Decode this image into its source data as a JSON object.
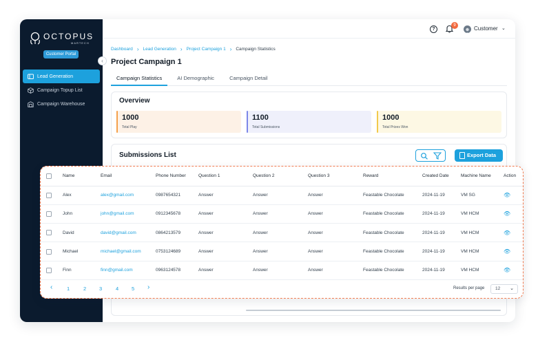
{
  "brand": {
    "name": "OCTOPUS",
    "sub": "MARTECH",
    "portal_badge": "Customer Portal"
  },
  "sidebar": {
    "items": [
      {
        "label": "Lead Generation",
        "icon": "megaphone-icon",
        "active": true
      },
      {
        "label": "Campaign Topup List",
        "icon": "box-icon",
        "active": false
      },
      {
        "label": "Campaign Warehouse",
        "icon": "warehouse-icon",
        "active": false
      }
    ]
  },
  "topbar": {
    "notification_count": "9",
    "user_label": "Customer"
  },
  "breadcrumb": [
    "Dashboard",
    "Lead Generation",
    "Project Campaign 1",
    "Campaign Statistics"
  ],
  "page_title": "Project Campaign 1",
  "tabs": [
    "Campaign Statistics",
    "AI Demographic",
    "Campaign Detail"
  ],
  "overview": {
    "title": "Overview",
    "stats": [
      {
        "value": "1000",
        "label": "Total Play",
        "color": "#f5a04a",
        "bg": "#fdf1e6"
      },
      {
        "value": "1100",
        "label": "Total Submissions",
        "color": "#7b86e8",
        "bg": "#eff0fb"
      },
      {
        "value": "1000",
        "label": "Total Prizes Won",
        "color": "#f2c94c",
        "bg": "#fdf8e4"
      }
    ]
  },
  "submissions": {
    "title": "Submissions List",
    "export_label": "Export Data",
    "columns": [
      "Name",
      "Email",
      "Phone Number",
      "Question 1",
      "Question 2",
      "Question 3",
      "Reward",
      "Created Date",
      "Machine Name",
      "Action"
    ],
    "rows": [
      [
        "Alex",
        "alex@gmail.com",
        "0987654321",
        "Answer",
        "Answer",
        "Answer",
        "Feastable Chocolate",
        "2024-11-19",
        "VM SG"
      ],
      [
        "John",
        "john@gmail.com",
        "0912345678",
        "Answer",
        "Answer",
        "Answer",
        "Feastable Chocolate",
        "2024-11-19",
        "VM HCM"
      ],
      [
        "David",
        "david@gmail.com",
        "0864213579",
        "Answer",
        "Answer",
        "Answer",
        "Feastable Chocolate",
        "2024-11-19",
        "VM HCM"
      ],
      [
        "Michael",
        "michael@gmail.com",
        "0753124689",
        "Answer",
        "Answer",
        "Answer",
        "Feastable Chocolate",
        "2024-11-19",
        "VM HCM"
      ],
      [
        "Finn",
        "finn@gmail.com",
        "0963124578",
        "Answer",
        "Answer",
        "Answer",
        "Feastable Chocolate",
        "2024-11-19",
        "VM HCM"
      ]
    ],
    "pages": [
      "1",
      "2",
      "3",
      "4",
      "5"
    ],
    "results_per_page_label": "Results per page",
    "results_per_page_value": "12"
  },
  "colors": {
    "accent": "#1da1dd",
    "sidebar_bg": "#0b1b2e",
    "highlight_border": "#f07a4f",
    "badge": "#f26a3f"
  }
}
